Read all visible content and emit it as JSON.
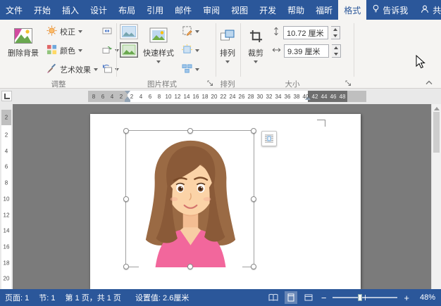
{
  "tabs": {
    "items": [
      {
        "id": "file",
        "label": "文件",
        "active": false
      },
      {
        "id": "home",
        "label": "开始",
        "active": false
      },
      {
        "id": "insert",
        "label": "插入",
        "active": false
      },
      {
        "id": "design",
        "label": "设计",
        "active": false
      },
      {
        "id": "layout",
        "label": "布局",
        "active": false
      },
      {
        "id": "references",
        "label": "引用",
        "active": false
      },
      {
        "id": "mailings",
        "label": "邮件",
        "active": false
      },
      {
        "id": "review",
        "label": "审阅",
        "active": false
      },
      {
        "id": "view",
        "label": "视图",
        "active": false
      },
      {
        "id": "developer",
        "label": "开发",
        "active": false
      },
      {
        "id": "help",
        "label": "帮助",
        "active": false
      },
      {
        "id": "foxit",
        "label": "福昕",
        "active": false
      },
      {
        "id": "format",
        "label": "格式",
        "active": true
      }
    ],
    "tell_me": "告诉我",
    "share": "共享"
  },
  "ribbon": {
    "adjust": {
      "remove_background": "删除背景",
      "corrections": "校正",
      "color": "颜色",
      "artistic_effects": "艺术效果",
      "group_label": "调整"
    },
    "picture_styles": {
      "quick_styles": "快速样式",
      "group_label": "图片样式"
    },
    "arrange": {
      "button": "排列",
      "group_label": "排列"
    },
    "size": {
      "crop": "裁剪",
      "height_value": "10.72 厘米",
      "width_value": "9.39 厘米",
      "group_label": "大小"
    }
  },
  "ruler": {
    "h_margin_numbers": [
      "8",
      "6",
      "4",
      "2"
    ],
    "h_content_numbers": [
      "2",
      "4",
      "6",
      "8",
      "10",
      "12",
      "14",
      "16",
      "18",
      "20",
      "22",
      "24",
      "26",
      "28",
      "30",
      "32",
      "34",
      "36",
      "38",
      "40"
    ],
    "h_right_numbers": [
      "42",
      "44",
      "46",
      "48"
    ],
    "v_margin_numbers": [
      "2"
    ],
    "v_content_numbers": [
      "2",
      "4",
      "6",
      "8",
      "10",
      "12",
      "14",
      "16",
      "18",
      "20"
    ]
  },
  "statusbar": {
    "page": "页面: 1",
    "section": "节: 1",
    "page_of_total": "第 1 页，共 1 页",
    "setting_value": "设置值: 2.6厘米",
    "zoom_percent": "48%"
  },
  "colors": {
    "accent_blue": "#2b579a",
    "ribbon_bg": "#f5f4f2",
    "canvas_gray": "#7b7b7b"
  }
}
